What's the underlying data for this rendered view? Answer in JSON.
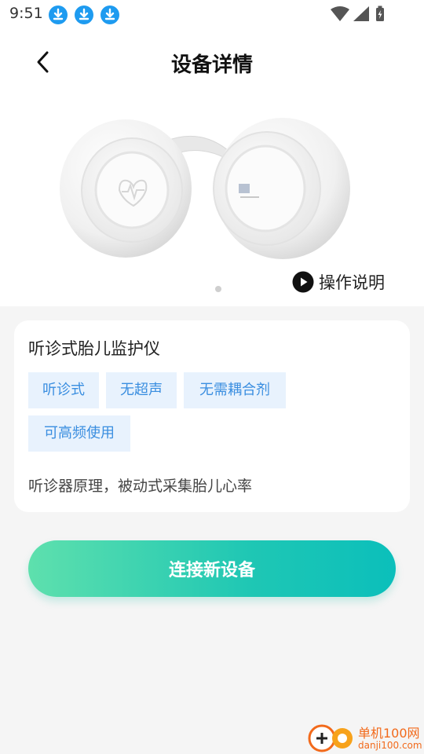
{
  "status_bar": {
    "time": "9:51",
    "download_icons": [
      "download-icon",
      "download-icon",
      "download-icon"
    ],
    "right_icons": [
      "wifi-icon",
      "signal-icon",
      "battery-charging-icon"
    ]
  },
  "header": {
    "title": "设备详情",
    "back_icon": "chevron-left-icon"
  },
  "product": {
    "carousel_count": 1,
    "carousel_active": 0,
    "guide_label": "操作说明",
    "guide_icon": "play-circle-icon"
  },
  "device_card": {
    "title": "听诊式胎儿监护仪",
    "tags": [
      "听诊式",
      "无超声",
      "无需耦合剂",
      "可高频使用"
    ],
    "description": "听诊器原理，被动式采集胎儿心率"
  },
  "connect_button": {
    "label": "连接新设备"
  },
  "colors": {
    "accent_start": "#5ee0ad",
    "accent_end": "#0bbfbb",
    "tag_bg": "#e8f2fd",
    "tag_text": "#3a8ee0",
    "download_icon": "#1e9bf0"
  },
  "watermark": {
    "text_cn": "单机100网",
    "text_en": "danji100.com"
  }
}
